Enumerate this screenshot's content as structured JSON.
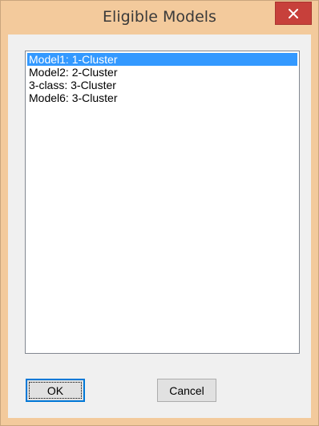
{
  "window": {
    "title": "Eligible Models"
  },
  "list": {
    "items": [
      {
        "label": "Model1: 1-Cluster",
        "selected": true
      },
      {
        "label": "Model2: 2-Cluster",
        "selected": false
      },
      {
        "label": "3-class: 3-Cluster",
        "selected": false
      },
      {
        "label": "Model6: 3-Cluster",
        "selected": false
      }
    ]
  },
  "buttons": {
    "ok_label": "OK",
    "cancel_label": "Cancel"
  },
  "icons": {
    "close": "close-icon"
  },
  "colors": {
    "frame": "#f3ca9c",
    "close": "#c7403b",
    "selection": "#3399ff",
    "client": "#f0f0f0"
  }
}
